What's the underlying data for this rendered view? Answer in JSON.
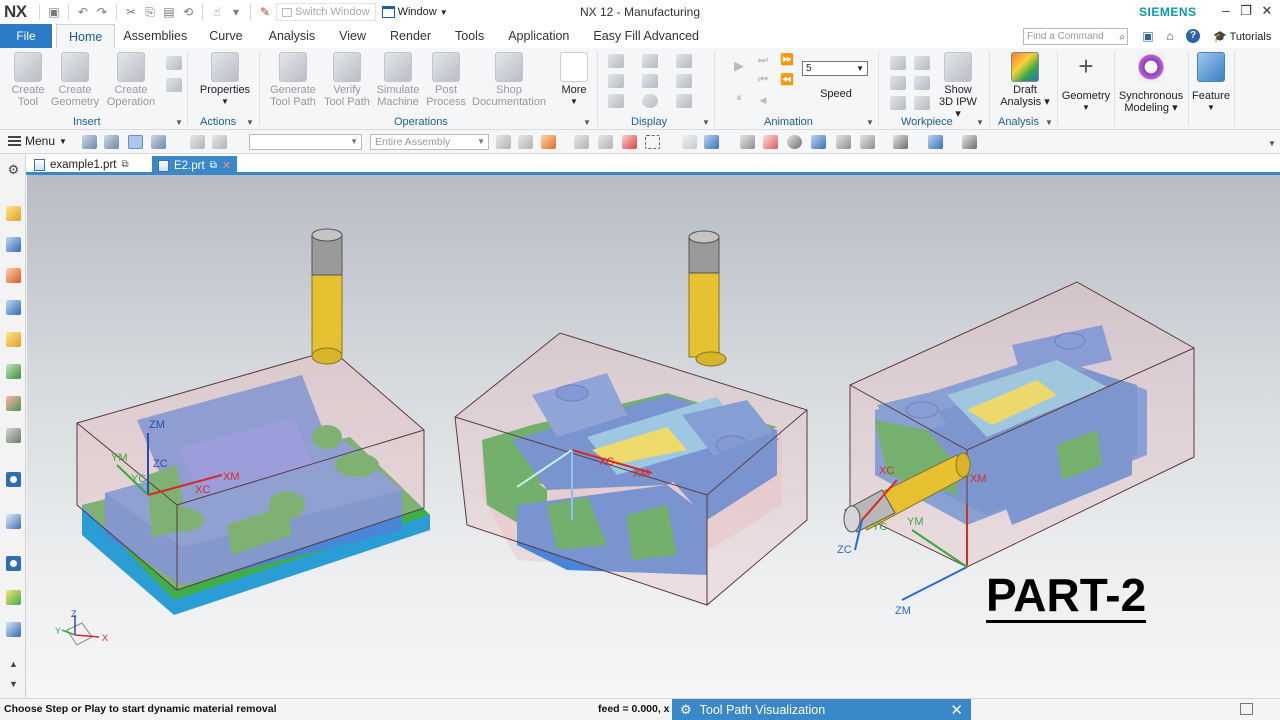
{
  "window": {
    "app_logo": "NX",
    "title": "NX 12 - Manufacturing",
    "brand": "SIEMENS",
    "switch_window_label": "Switch Window",
    "window_menu_label": "Window"
  },
  "menu_tabs": [
    "File",
    "Home",
    "Assemblies",
    "Curve",
    "Analysis",
    "View",
    "Render",
    "Tools",
    "Application",
    "Easy Fill Advanced"
  ],
  "active_tab": "Home",
  "find_command_placeholder": "Find a Command",
  "tutorials_label": "Tutorials",
  "ribbon": {
    "insert": {
      "group_label": "Insert",
      "buttons": [
        {
          "line1": "Create",
          "line2": "Tool"
        },
        {
          "line1": "Create",
          "line2": "Geometry"
        },
        {
          "line1": "Create",
          "line2": "Operation"
        }
      ]
    },
    "actions": {
      "group_label": "Actions",
      "properties_label": "Properties"
    },
    "operations": {
      "group_label": "Operations",
      "buttons": [
        {
          "line1": "Generate",
          "line2": "Tool Path"
        },
        {
          "line1": "Verify",
          "line2": "Tool Path"
        },
        {
          "line1": "Simulate",
          "line2": "Machine"
        },
        {
          "line1": "Post",
          "line2": "Process"
        },
        {
          "line1": "Shop",
          "line2": "Documentation"
        }
      ]
    },
    "more_label": "More",
    "display": {
      "group_label": "Display"
    },
    "animation": {
      "group_label": "Animation",
      "speed_value": "5",
      "speed_label": "Speed"
    },
    "workpiece": {
      "group_label": "Workpiece",
      "show_line1": "Show",
      "show_line2": "3D IPW"
    },
    "analysis": {
      "group_label": "Analysis",
      "draft_line1": "Draft",
      "draft_line2": "Analysis"
    },
    "geometry_label": "Geometry",
    "sync_line1": "Synchronous",
    "sync_line2": "Modeling",
    "feature_label": "Feature"
  },
  "toolbar": {
    "menu_label": "Menu",
    "filter_value": "",
    "assembly_filter": "Entire Assembly"
  },
  "doc_tabs": [
    {
      "label": "example1.prt",
      "active": false
    },
    {
      "label": "E2.prt",
      "active": true
    }
  ],
  "viewport": {
    "overlay_text": "PART-2",
    "axes_labels": {
      "part1": [
        "ZM",
        "YM",
        "YC",
        "ZC",
        "XC",
        "XM"
      ],
      "part2": [
        "XC",
        "XM"
      ],
      "part3": [
        "XC",
        "XM",
        "YC",
        "YM",
        "ZC",
        "ZM"
      ],
      "triad": [
        "Z",
        "Y",
        "X"
      ]
    }
  },
  "status": {
    "message": "Choose Step or Play to start dynamic material removal",
    "feed": "feed = 0.000, x"
  },
  "tool_path_panel": {
    "title": "Tool Path Visualization"
  },
  "colors": {
    "accent": "#3a88c8",
    "file_tab": "#2b7bc9",
    "siemens": "#0a9bab",
    "part_blue": "#4a86d8",
    "part_green": "#3fae49",
    "stock_pink": "#e8b6b9",
    "tool_yellow": "#e6c233"
  }
}
